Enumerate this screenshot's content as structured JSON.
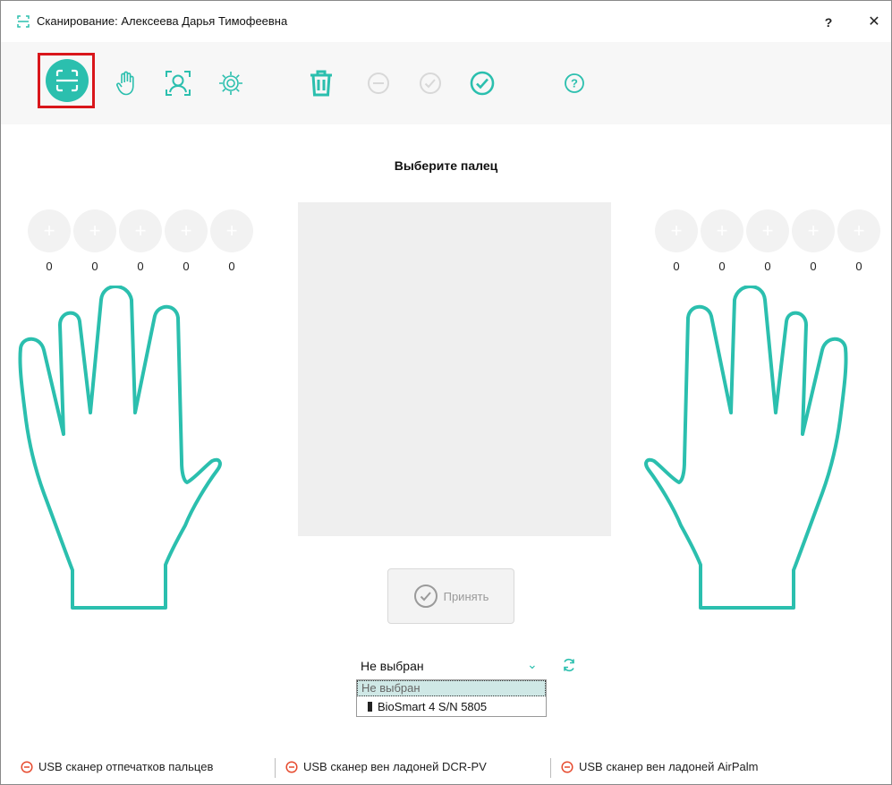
{
  "window": {
    "title": "Сканирование: Алексеева  Дарья  Тимофеевна",
    "help_label": "?",
    "close_label": "✕"
  },
  "toolbar": {
    "icons": [
      "scan-icon",
      "hand-icon",
      "face-scan-icon",
      "settings-icon",
      "trash-icon",
      "minus-circle-icon",
      "check-circle-icon",
      "check-circle-icon",
      "help-circle-icon"
    ],
    "help_label": "?"
  },
  "main": {
    "heading": "Выберите палец",
    "left_fingers": {
      "add_labels": [
        "+",
        "+",
        "+",
        "+",
        "+"
      ],
      "counts": [
        "0",
        "0",
        "0",
        "0",
        "0"
      ]
    },
    "right_fingers": {
      "add_labels": [
        "+",
        "+",
        "+",
        "+",
        "+"
      ],
      "counts": [
        "0",
        "0",
        "0",
        "0",
        "0"
      ]
    },
    "accept_label": "Принять"
  },
  "scanner_select": {
    "value": "Не выбран",
    "chevron": "⌄",
    "options": [
      "Не выбран",
      "BioSmart 4 S/N 5805"
    ]
  },
  "status_bar": {
    "items": [
      "USB сканер отпечатков пальцев",
      "USB сканер вен ладоней DCR-PV",
      "USB сканер вен ладоней AirPalm"
    ]
  },
  "colors": {
    "accent": "#2bbfae",
    "error": "#e64a2e",
    "highlight_frame": "#d9161b"
  }
}
